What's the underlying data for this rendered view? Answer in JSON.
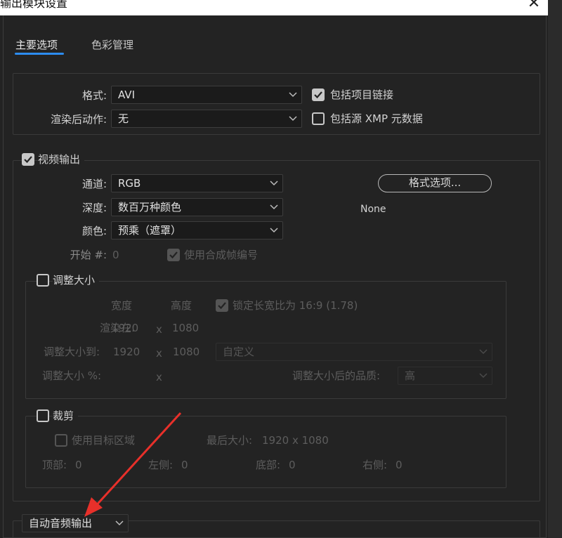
{
  "window": {
    "title": "输出模块设置",
    "close_glyph": "✕"
  },
  "tabs": [
    {
      "label": "主要选项",
      "active": true
    },
    {
      "label": "色彩管理",
      "active": false
    }
  ],
  "format": {
    "format_label": "格式:",
    "format_value": "AVI",
    "post_render_label": "渲染后动作:",
    "post_render_value": "无",
    "include_project_link": {
      "label": "包括项目链接",
      "checked": true
    },
    "include_xmp": {
      "label": "包括源 XMP 元数据",
      "checked": false
    }
  },
  "video_output": {
    "label": "视频输出",
    "checked": true,
    "channels_label": "通道:",
    "channels_value": "RGB",
    "depth_label": "深度:",
    "depth_value": "数百万种颜色",
    "color_label": "颜色:",
    "color_value": "预乘（遮罩）",
    "format_options_button": "格式选项...",
    "codec_info": "None",
    "start_label": "开始 #:",
    "start_value": "0",
    "use_comp_frame": {
      "label": "使用合成帧编号",
      "checked": true
    }
  },
  "resize": {
    "label": "调整大小",
    "checked": false,
    "width_header": "宽度",
    "height_header": "高度",
    "lock_aspect": {
      "label": "锁定长宽比为 16:9 (1.78)",
      "checked": true
    },
    "render_at_label": "渲染在:",
    "render_w": "1920",
    "render_h": "1080",
    "resize_to_label": "调整大小到:",
    "resize_w": "1920",
    "resize_h": "1080",
    "preset_value": "自定义",
    "percent_label": "调整大小 %:",
    "x_sep": "x",
    "quality_label": "调整大小后的品质:",
    "quality_value": "高"
  },
  "crop": {
    "label": "裁剪",
    "checked": false,
    "use_roi": {
      "label": "使用目标区域",
      "checked": false
    },
    "final_size_label": "最后大小:",
    "final_size_value": "1920 x 1080",
    "top_label": "顶部:",
    "top_value": "0",
    "left_label": "左侧:",
    "left_value": "0",
    "bottom_label": "底部:",
    "bottom_value": "0",
    "right_label": "右侧:",
    "right_value": "0"
  },
  "audio": {
    "value": "自动音频输出"
  },
  "colors": {
    "accent_tab": "#2c8cf0",
    "arrow": "#e8302a"
  }
}
